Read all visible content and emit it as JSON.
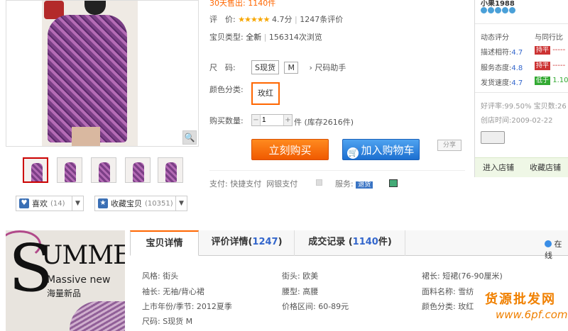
{
  "summary": {
    "sales_label": "30天售出:",
    "sales_value": "1140件",
    "rating_label": "评　价:",
    "stars": "★★★★★",
    "rating_score": "4.7分",
    "rating_count": "1247条评价",
    "type_label": "宝贝类型:",
    "type_value": "全新",
    "views": "156314次浏览"
  },
  "size": {
    "label": "尺　码:",
    "options": [
      "S现货",
      "M"
    ],
    "helper": "尺码助手"
  },
  "color": {
    "label": "颜色分类:",
    "selected": "玫红"
  },
  "quantity": {
    "label": "购买数量:",
    "value": "1",
    "unit": "件",
    "stock": "(库存2616件)"
  },
  "actions": {
    "buy_now": "立刻购买",
    "add_cart": "加入购物车",
    "share": "分享"
  },
  "payment": {
    "label": "支付:",
    "quick": "快捷支付",
    "bank": "网银支付",
    "service_label": "服务:",
    "service_badge": "退货"
  },
  "gallery": {
    "like_label": "喜欢",
    "like_count": "(14)",
    "fav_label": "收藏宝贝",
    "fav_count": "(10351)"
  },
  "shop": {
    "name": "小果1988",
    "score_title": "动态评分",
    "compare_title": "与同行比",
    "rows": [
      {
        "label": "描述相符:",
        "score": "4.7",
        "flag": "持平",
        "cmp": "-----"
      },
      {
        "label": "服务态度:",
        "score": "4.8",
        "flag": "持平",
        "cmp": "-----"
      },
      {
        "label": "发货速度:",
        "score": "4.7",
        "flag": "低于",
        "cmp": "1.10"
      }
    ],
    "good_rate": "好评率:99.50% 宝贝数:26",
    "created": "创店时间:2009-02-22",
    "enter": "进入店铺",
    "fav_shop": "收藏店铺"
  },
  "banner": {
    "S": "S",
    "ummer": "UMMER",
    "mass": "Massive new",
    "cn": "海量新品"
  },
  "tabs": [
    {
      "label": "宝贝详情",
      "count": ""
    },
    {
      "label": "评价详情(",
      "count": "1247",
      "tail": ")"
    },
    {
      "label": "成交记录 (",
      "count": "1140",
      "tail": "件)"
    }
  ],
  "online": "在线",
  "attributes": [
    [
      "风格: 街头",
      "街头: 欧美",
      "裙长: 短裙(76-90厘米)"
    ],
    [
      "袖长: 无袖/背心裙",
      "腰型: 高腰",
      "面料名称: 雪纺"
    ],
    [
      "上市年份/季节: 2012夏季",
      "价格区间: 60-89元",
      "颜色分类: 玫红"
    ],
    [
      "尺码: S现货 M",
      "",
      ""
    ]
  ],
  "watermark": {
    "line1": "货源批发网",
    "line2": "www.6pf.com"
  },
  "colors": {
    "accent": "#f60",
    "buy": "#f05a00",
    "cart": "#1c6fd0",
    "link": "#36c"
  }
}
